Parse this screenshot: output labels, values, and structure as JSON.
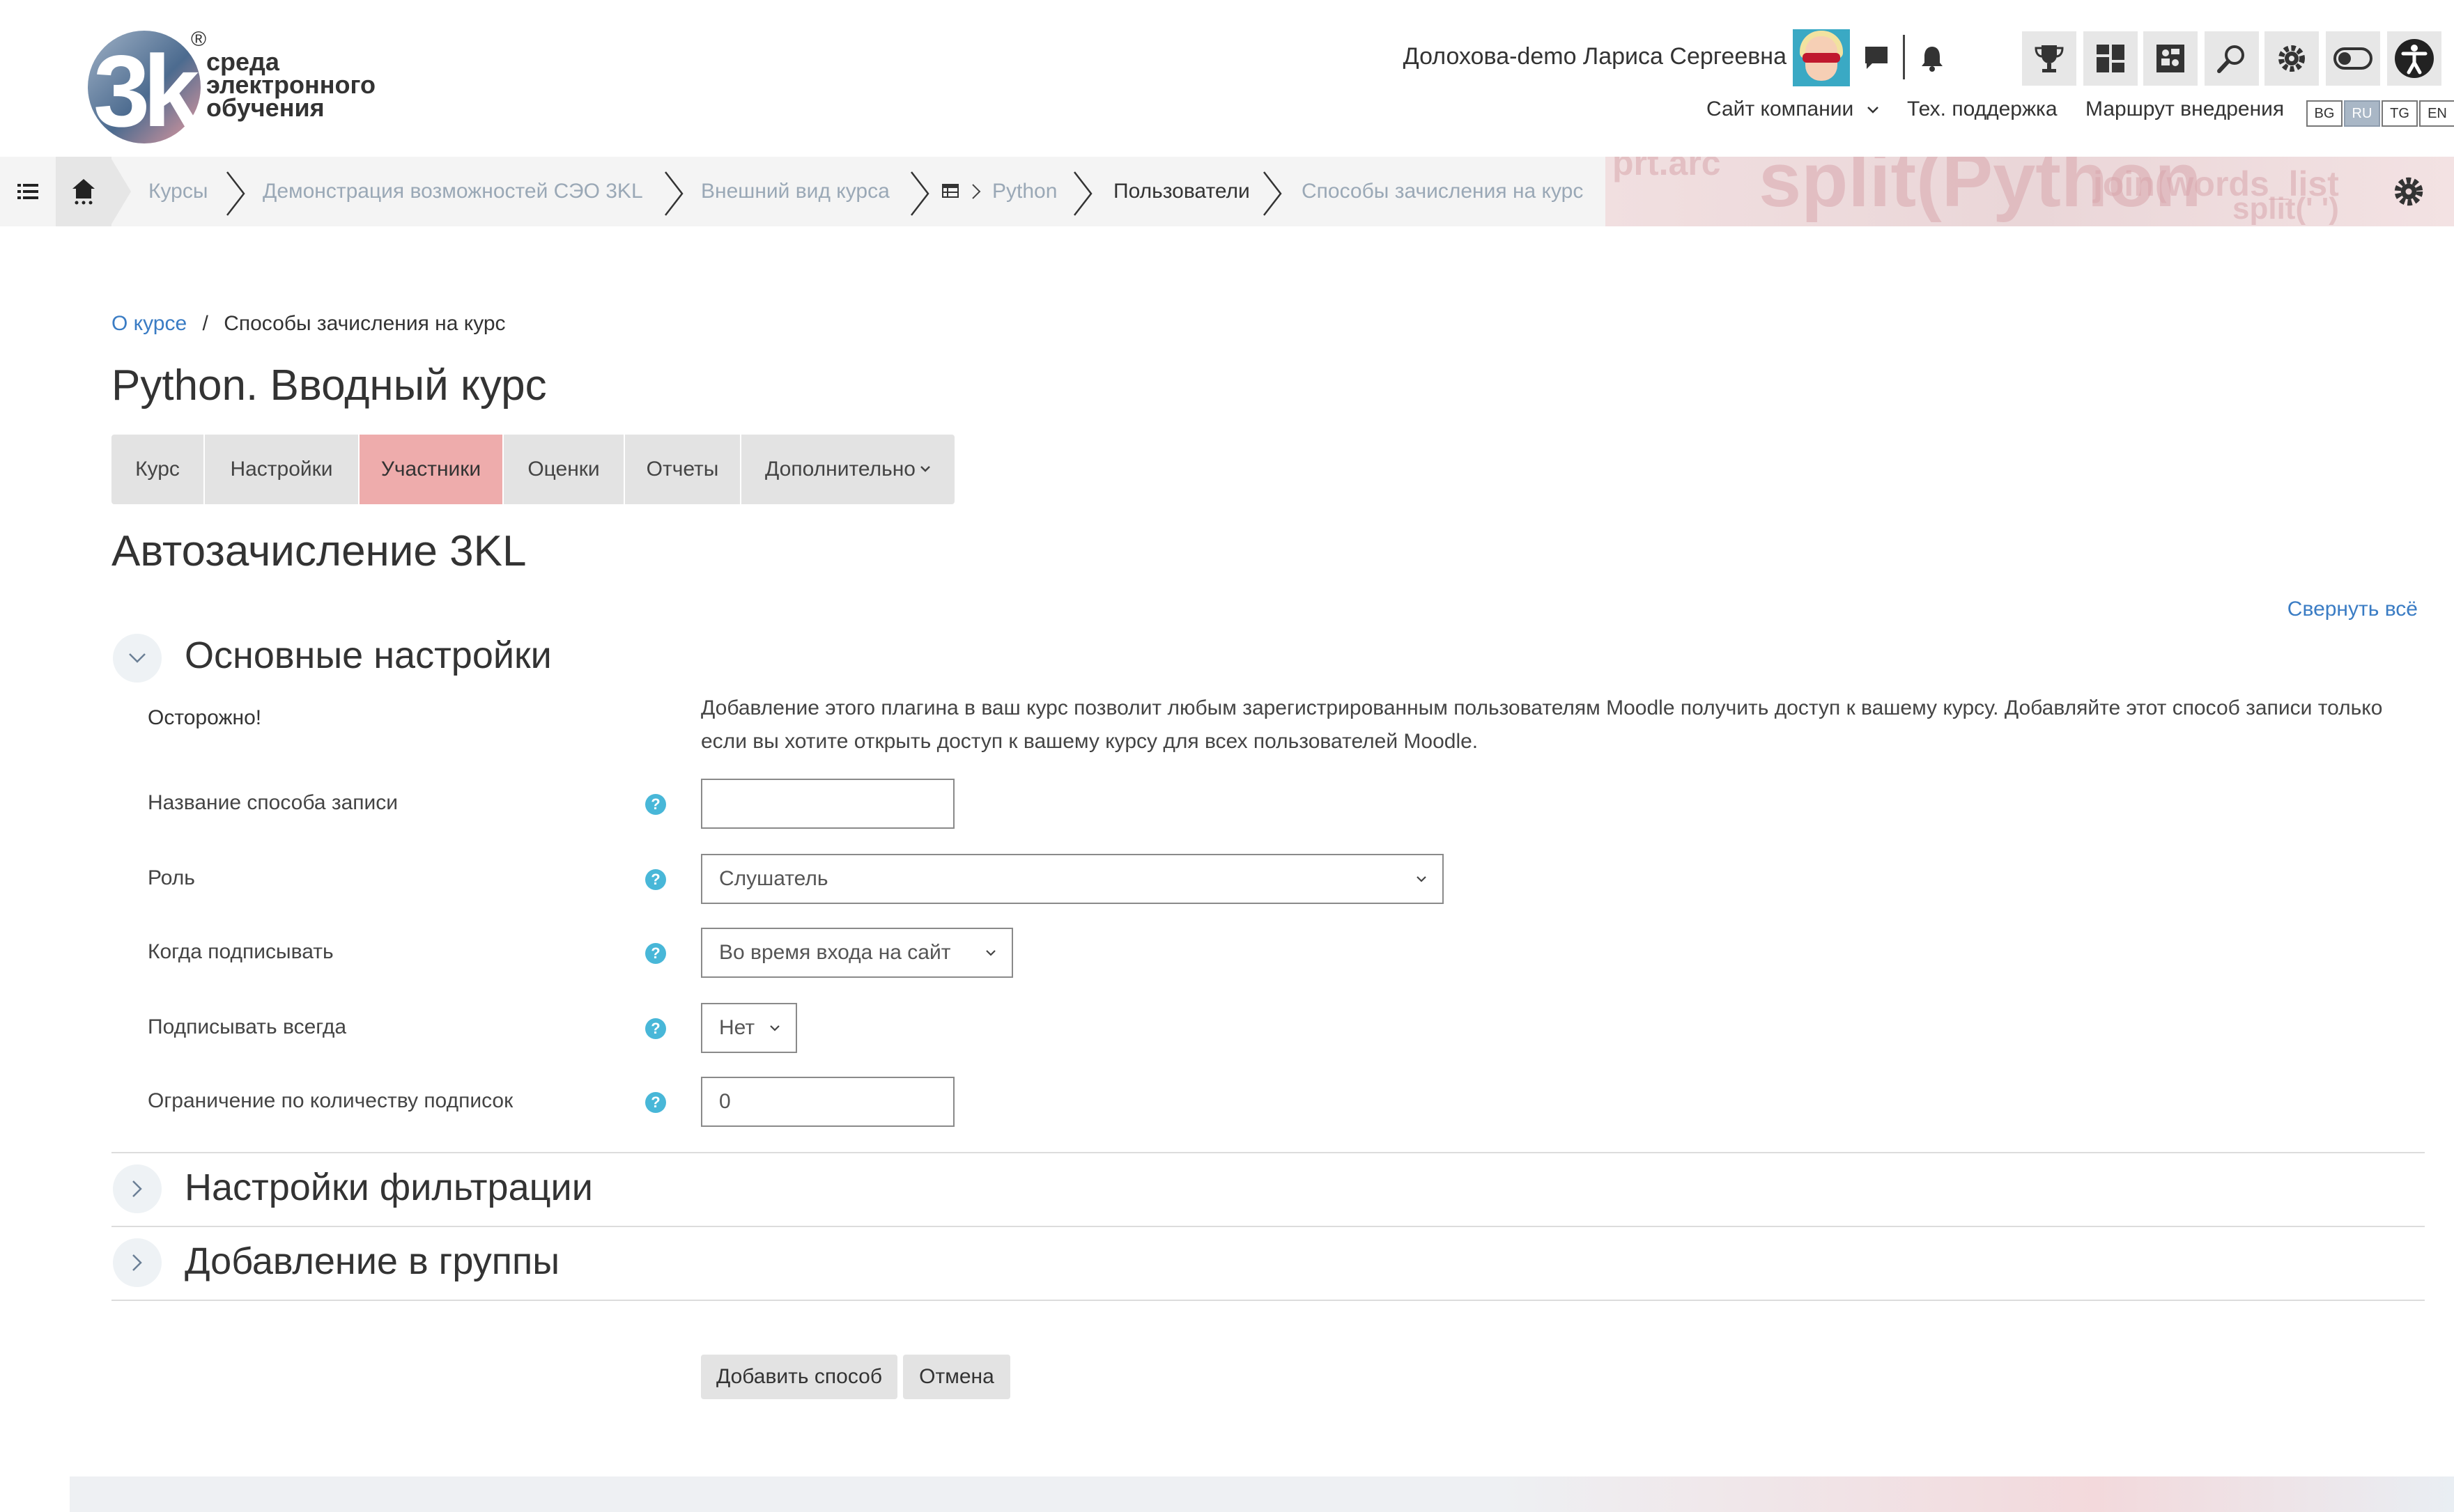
{
  "header": {
    "logo": {
      "mark": "3k",
      "reg": "®",
      "lines": [
        "среда",
        "электронного",
        "обучения"
      ]
    },
    "user_name": "Долохова-demo Лариса Сергеевна",
    "nav": {
      "company": "Сайт компании",
      "support": "Тех. поддержка",
      "route": "Маршрут внедрения"
    },
    "languages": [
      "BG",
      "RU",
      "TG",
      "EN"
    ],
    "active_language": "RU"
  },
  "breadcrumbs": {
    "items": [
      "Курсы",
      "Демонстрация возможностей СЭО 3KL",
      "Внешний вид курса",
      "Python",
      "Пользователи",
      "Способы зачисления на курс"
    ],
    "current": "Пользователи",
    "background_words": [
      "prt.arc",
      "split(Python",
      "join(words_list",
      "split(' ')"
    ]
  },
  "content": {
    "breadcrumb": {
      "link": "О курсе",
      "sep": "/",
      "current": "Способы зачисления на курс"
    },
    "course_title": "Python. Вводный курс",
    "tabs": [
      "Курс",
      "Настройки",
      "Участники",
      "Оценки",
      "Отчеты",
      "Дополнительно"
    ],
    "active_tab": "Участники",
    "page_heading": "Автозачисление 3KL",
    "collapse_all": "Свернуть всё",
    "sections": {
      "main": "Основные настройки",
      "filter": "Настройки фильтрации",
      "groups": "Добавление в группы"
    },
    "warning": {
      "label": "Осторожно!",
      "text": "Добавление этого плагина в ваш курс позволит любым зарегистрированным пользователям Moodle получить доступ к вашему курсу. Добавляйте этот способ записи только если вы хотите открыть доступ к вашему курсу для всех пользователей Moodle."
    },
    "fields": {
      "name": {
        "label": "Название способа записи",
        "value": ""
      },
      "role": {
        "label": "Роль",
        "value": "Слушатель"
      },
      "when": {
        "label": "Когда подписывать",
        "value": "Во время входа на сайт"
      },
      "always": {
        "label": "Подписывать всегда",
        "value": "Нет"
      },
      "limit": {
        "label": "Ограничение по количеству подписок",
        "value": "0"
      }
    },
    "help_glyph": "?",
    "buttons": {
      "add": "Добавить способ",
      "cancel": "Отмена"
    }
  },
  "colors": {
    "accent_link": "#3a7cc4",
    "active_tab": "#eeacac",
    "help_icon": "#48b7d8",
    "breadcrumb_muted": "#9aa8b6"
  }
}
